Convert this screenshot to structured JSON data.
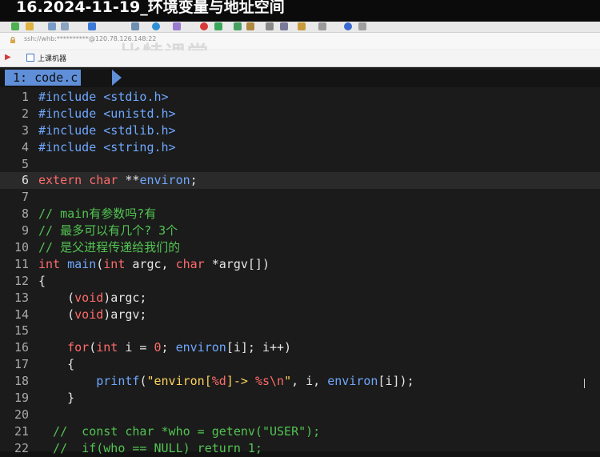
{
  "video_title": "16.2024-11-19_环境变量与地址空间",
  "xshell": {
    "address": "ssh://whb:**********@120.78.126.148:22",
    "watermark": "比特课堂",
    "session_tab": "上课机器"
  },
  "editor": {
    "buffer_tab": "1: code.c",
    "cursor_line": 6,
    "lines": [
      {
        "no": "1",
        "tokens": [
          {
            "t": "#include",
            "c": "inc"
          },
          {
            "t": " ",
            "c": "pl"
          },
          {
            "t": "<stdio.h>",
            "c": "hdr"
          }
        ]
      },
      {
        "no": "2",
        "tokens": [
          {
            "t": "#include",
            "c": "inc"
          },
          {
            "t": " ",
            "c": "pl"
          },
          {
            "t": "<unistd.h>",
            "c": "hdr"
          }
        ]
      },
      {
        "no": "3",
        "tokens": [
          {
            "t": "#include",
            "c": "inc"
          },
          {
            "t": " ",
            "c": "pl"
          },
          {
            "t": "<stdlib.h>",
            "c": "hdr"
          }
        ]
      },
      {
        "no": "4",
        "tokens": [
          {
            "t": "#include",
            "c": "inc"
          },
          {
            "t": " ",
            "c": "pl"
          },
          {
            "t": "<string.h>",
            "c": "hdr"
          }
        ]
      },
      {
        "no": "5",
        "tokens": []
      },
      {
        "no": "6",
        "tokens": [
          {
            "t": "extern",
            "c": "kw"
          },
          {
            "t": " ",
            "c": "pl"
          },
          {
            "t": "char",
            "c": "ty"
          },
          {
            "t": " **",
            "c": "pl"
          },
          {
            "t": "environ",
            "c": "fn"
          },
          {
            "t": ";",
            "c": "pl"
          }
        ]
      },
      {
        "no": "7",
        "tokens": []
      },
      {
        "no": "8",
        "tokens": [
          {
            "t": "// main有参数吗?有",
            "c": "cm"
          }
        ]
      },
      {
        "no": "9",
        "tokens": [
          {
            "t": "// 最多可以有几个? 3个",
            "c": "cm"
          }
        ]
      },
      {
        "no": "10",
        "tokens": [
          {
            "t": "// 是父进程传递给我们的",
            "c": "cm"
          }
        ]
      },
      {
        "no": "11",
        "tokens": [
          {
            "t": "int",
            "c": "ty"
          },
          {
            "t": " ",
            "c": "pl"
          },
          {
            "t": "main",
            "c": "fn"
          },
          {
            "t": "(",
            "c": "pl"
          },
          {
            "t": "int",
            "c": "ty"
          },
          {
            "t": " argc, ",
            "c": "pl"
          },
          {
            "t": "char",
            "c": "ty"
          },
          {
            "t": " *argv[])",
            "c": "pl"
          }
        ]
      },
      {
        "no": "12",
        "tokens": [
          {
            "t": "{",
            "c": "pl"
          }
        ]
      },
      {
        "no": "13",
        "tokens": [
          {
            "t": "    (",
            "c": "pl"
          },
          {
            "t": "void",
            "c": "ty"
          },
          {
            "t": ")argc;",
            "c": "pl"
          }
        ]
      },
      {
        "no": "14",
        "tokens": [
          {
            "t": "    (",
            "c": "pl"
          },
          {
            "t": "void",
            "c": "ty"
          },
          {
            "t": ")argv;",
            "c": "pl"
          }
        ]
      },
      {
        "no": "15",
        "tokens": []
      },
      {
        "no": "16",
        "tokens": [
          {
            "t": "    ",
            "c": "pl"
          },
          {
            "t": "for",
            "c": "kw"
          },
          {
            "t": "(",
            "c": "pl"
          },
          {
            "t": "int",
            "c": "ty"
          },
          {
            "t": " i = ",
            "c": "pl"
          },
          {
            "t": "0",
            "c": "nm"
          },
          {
            "t": "; ",
            "c": "pl"
          },
          {
            "t": "environ",
            "c": "fn"
          },
          {
            "t": "[i]; i++)",
            "c": "pl"
          }
        ]
      },
      {
        "no": "17",
        "tokens": [
          {
            "t": "    {",
            "c": "pl"
          }
        ]
      },
      {
        "no": "18",
        "tokens": [
          {
            "t": "        ",
            "c": "pl"
          },
          {
            "t": "printf",
            "c": "fn"
          },
          {
            "t": "(",
            "c": "pl"
          },
          {
            "t": "\"environ[",
            "c": "str"
          },
          {
            "t": "%d",
            "c": "fmt"
          },
          {
            "t": "]-> ",
            "c": "str"
          },
          {
            "t": "%s\\n",
            "c": "fmt"
          },
          {
            "t": "\"",
            "c": "str"
          },
          {
            "t": ", i, ",
            "c": "pl"
          },
          {
            "t": "environ",
            "c": "fn"
          },
          {
            "t": "[i]);",
            "c": "pl"
          }
        ]
      },
      {
        "no": "19",
        "tokens": [
          {
            "t": "    }",
            "c": "pl"
          }
        ]
      },
      {
        "no": "20",
        "tokens": []
      },
      {
        "no": "21",
        "tokens": [
          {
            "t": "  //  const char *who = getenv(\"USER\");",
            "c": "cm"
          }
        ]
      },
      {
        "no": "22",
        "tokens": [
          {
            "t": "  //  if(who == NULL) return 1;",
            "c": "cm"
          }
        ]
      }
    ]
  },
  "colors": {
    "comment": "#52c452",
    "keyword": "#ff6b6b",
    "identifier": "#6fa8ff",
    "string": "#ffd35c",
    "tab_highlight": "#5f8fd8"
  }
}
